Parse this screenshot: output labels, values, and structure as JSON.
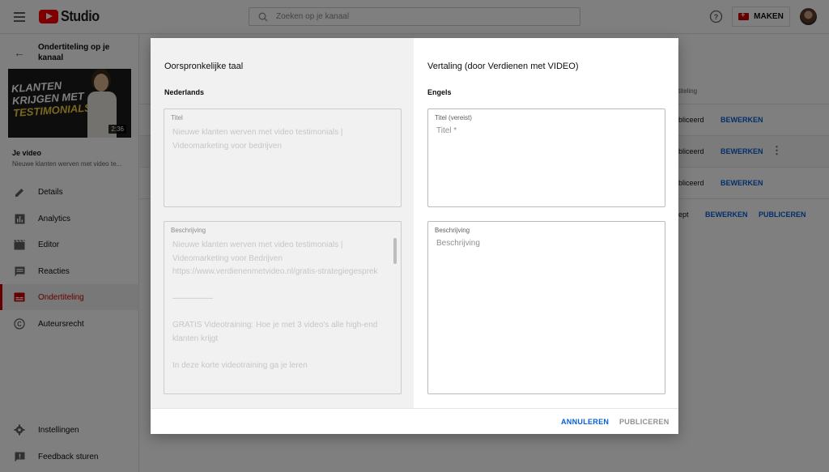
{
  "topbar": {
    "logo_text": "Studio",
    "search_placeholder": "Zoeken op je kanaal",
    "create_label": "MAKEN"
  },
  "sidebar": {
    "video_title": "Ondertiteling op je kanaal",
    "thumbnail": {
      "line1": "KLANTEN",
      "line2": "KRIJGEN MET",
      "line3": "TESTIMONIALS",
      "duration": "2:36"
    },
    "your_video_label": "Je video",
    "your_video_name": "Nieuwe klanten werven met video te...",
    "items": [
      {
        "label": "Details",
        "icon": "pencil-icon"
      },
      {
        "label": "Analytics",
        "icon": "analytics-icon"
      },
      {
        "label": "Editor",
        "icon": "clapperboard-icon"
      },
      {
        "label": "Reacties",
        "icon": "comment-icon"
      },
      {
        "label": "Ondertiteling",
        "icon": "subtitles-icon",
        "active": true
      },
      {
        "label": "Auteursrecht",
        "icon": "copyright-icon"
      }
    ],
    "bottom_items": [
      {
        "label": "Instellingen",
        "icon": "gear-icon"
      },
      {
        "label": "Feedback sturen",
        "icon": "feedback-icon"
      }
    ]
  },
  "background_table": {
    "header": "titeling",
    "rows": [
      {
        "status": "bliceerd",
        "actions": [
          "BEWERKEN"
        ]
      },
      {
        "status": "bliceerd",
        "actions": [
          "BEWERKEN"
        ],
        "menu": "⋮"
      },
      {
        "status": "bliceerd",
        "actions": [
          "BEWERKEN"
        ]
      },
      {
        "status": "ept",
        "actions": [
          "BEWERKEN",
          "PUBLICEREN"
        ]
      }
    ]
  },
  "modal": {
    "left": {
      "title": "Oorspronkelijke taal",
      "language": "Nederlands",
      "title_field_label": "Titel",
      "title_value": "Nieuwe klanten werven met video testimonials | Videomarketing voor bedrijven",
      "description_label": "Beschrijving",
      "description_value": "Nieuwe klanten werven met video testimonials | Videomarketing voor Bedrijven\nhttps://www.verdienenmetvideo.nl/gratis-strategiegesprek\n\n—————\n\nGRATIS Videotraining: Hoe je met 3 video's alle high-end klanten krijgt\n\nIn deze korte videotraining ga je leren"
    },
    "right": {
      "title": "Vertaling (door Verdienen met VIDEO)",
      "language": "Engels",
      "title_field_label": "Titel (vereist)",
      "title_placeholder": "Titel *",
      "description_label": "Beschrijving",
      "description_placeholder": "Beschrijving"
    },
    "footer": {
      "cancel_label": "ANNULEREN",
      "publish_label": "PUBLICEREN"
    }
  },
  "colors": {
    "brand_red": "#ff0000",
    "active_red": "#cc0000",
    "link_blue": "#065fd4"
  }
}
